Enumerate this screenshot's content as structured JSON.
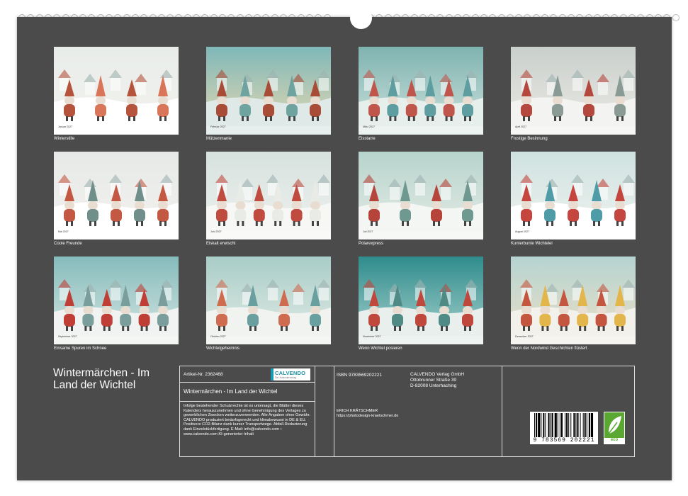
{
  "calendar": {
    "title": "Wintermärchen - Im Land der Wichtel",
    "months": [
      {
        "label": "Januar 2027",
        "caption": "Winterstille"
      },
      {
        "label": "Februar 2027",
        "caption": "Mützenmanie"
      },
      {
        "label": "März 2027",
        "caption": "Eisstarre"
      },
      {
        "label": "April 2027",
        "caption": "Frostige Besinnung"
      },
      {
        "label": "Mai 2027",
        "caption": "Coole Freunde"
      },
      {
        "label": "Juni 2027",
        "caption": "Eiskalt erwischt"
      },
      {
        "label": "Juli 2027",
        "caption": "Polarexpress"
      },
      {
        "label": "August 2027",
        "caption": "Kunterbunte Wichtelei"
      },
      {
        "label": "September 2027",
        "caption": "Einsame Spuren im Schnee"
      },
      {
        "label": "Oktober 2027",
        "caption": "Wichtelgeheimnis"
      },
      {
        "label": "November 2027",
        "caption": "Wenn Wichtel posieren"
      },
      {
        "label": "Dezember 2027",
        "caption": "Wenn der Nordwind Geschichten flüstert"
      }
    ]
  },
  "info": {
    "artikel": "Artikel-Nr. 2362468",
    "logo_text": "CALVENDO",
    "logo_sub": "Der Kalenderverlag",
    "product_title": "Wintermärchen - Im Land der Wichtel",
    "legal": "Infolge bestehender Schutzrechte ist es untersagt, die Blätter dieses Kalenders herauszunehmen und ohne Genehmigung des Verlages zu gewerblichen Zwecken weiterzuverwenden. Alle Angaben ohne Gewähr. CALVENDO produziert bedarfsgerecht und klimabewusst in DE & EU. Positivere CO2-Bilanz dank kurzer Transportwege. Abfall-Reduzierung dank Einzelstückfertigung. E-Mail: info@calvendo.com • www.calvendo.com KI-generierter Inhalt",
    "isbn": "ISBN 9783569202221",
    "publisher_name": "CALVENDO Verlag GmbH",
    "publisher_street": "Ottobrunner Straße 39",
    "publisher_city": "D-82008 Unterhaching",
    "author": "ERICH KRÄTSCHMER",
    "author_url": "https://photodesign-kraetschmer.de",
    "barcode_number": "9 783569 202221",
    "eco_label": "eco"
  },
  "colors": {
    "background": "#4b4b4b",
    "text": "#ffffff",
    "logo_blue": "#1b9bb2",
    "eco_green": "#5aa832"
  }
}
